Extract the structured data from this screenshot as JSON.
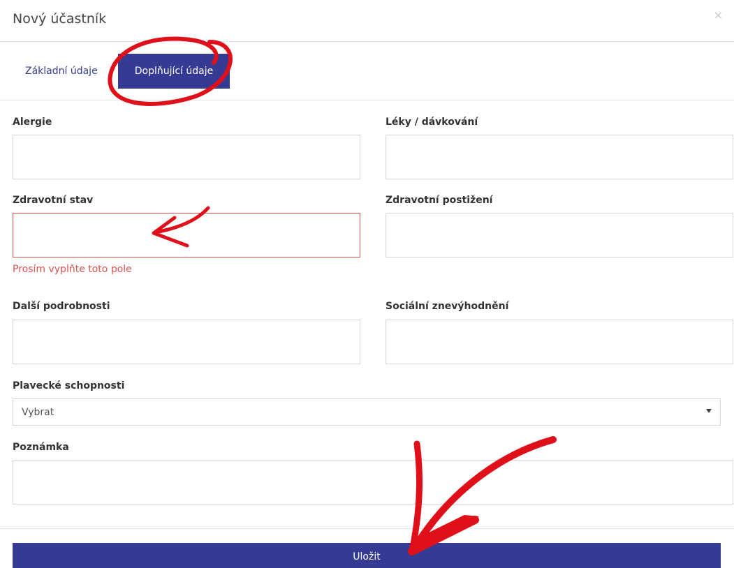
{
  "modal": {
    "title": "Nový účastník",
    "close_label": "×"
  },
  "tabs": [
    {
      "label": "Základní údaje",
      "active": false
    },
    {
      "label": "Doplňující údaje",
      "active": true
    }
  ],
  "fields": {
    "alergie": {
      "label": "Alergie",
      "value": ""
    },
    "leky": {
      "label": "Léky / dávkování",
      "value": ""
    },
    "zdravotni_stav": {
      "label": "Zdravotní stav",
      "value": "",
      "error": "Prosím vyplňte toto pole"
    },
    "zdravotni_postizeni": {
      "label": "Zdravotní postižení",
      "value": ""
    },
    "dalsi_podrobnosti": {
      "label": "Další podrobnosti",
      "value": ""
    },
    "socialni_znevyhodneni": {
      "label": "Sociální znevýhodnění",
      "value": ""
    },
    "plavecke_schopnosti": {
      "label": "Plavecké schopnosti",
      "selected": "Vybrat"
    },
    "poznamka": {
      "label": "Poznámka",
      "value": ""
    }
  },
  "actions": {
    "save_label": "Uložit"
  },
  "colors": {
    "accent": "#353a93",
    "error": "#d9534f",
    "annotation": "#e0101a"
  }
}
